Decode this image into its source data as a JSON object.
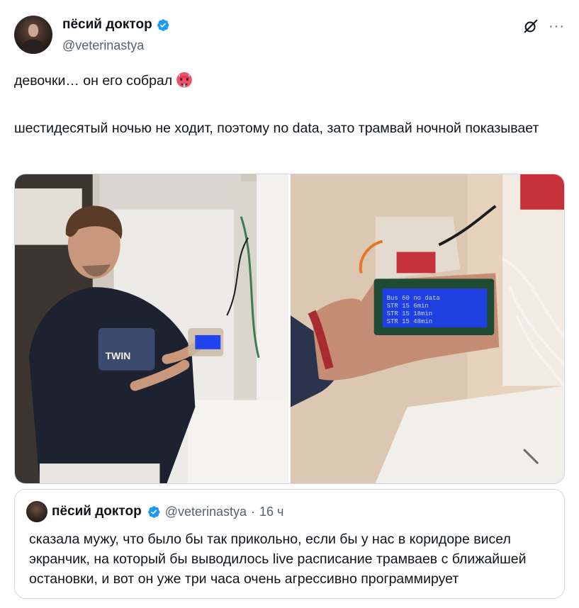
{
  "tweet": {
    "author": {
      "display_name": "пёсий доктор",
      "handle": "@veterinastya",
      "verified": true,
      "verified_color": "#1d9bf0",
      "avatar_icon": "avatar-photo"
    },
    "header_icons": [
      "grok-icon",
      "more-icon"
    ],
    "more_label": "···",
    "text_line_1": "девочки… он его собрал",
    "text_emoji": "hot-face-emoji",
    "text_line_2": "шестидесятый ночью не ходит, поэтому no data, зато трамвай ночной показывает",
    "media": {
      "photo_1": "man-holding-lcd-device-photo",
      "photo_2": "hand-holding-lcd-device-photo",
      "lcd_lines": [
        "Bus 60   no data",
        "STR 15    6min",
        "STR 15   18min",
        "STR 15   48min"
      ]
    }
  },
  "quoted_tweet": {
    "display_name": "пёсий доктор",
    "handle": "@veterinastya",
    "separator": "·",
    "time": "16 ч",
    "text": "сказала мужу, что было бы так прикольно, если бы у нас в коридоре висел экранчик, на который бы выводилось live расписание трамваев с ближайшей остановки, и вот он уже три часа очень агрессивно программирует"
  },
  "colors": {
    "text_primary": "#0f1419",
    "text_secondary": "#536471",
    "border": "#cfd9de",
    "lcd_blue": "#1f3fe0"
  }
}
